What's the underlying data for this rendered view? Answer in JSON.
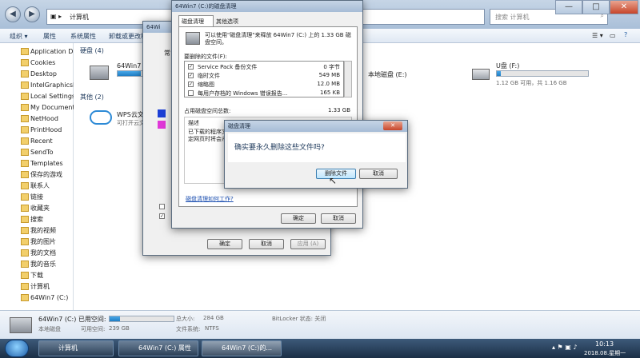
{
  "explorer": {
    "address": [
      "计算机"
    ],
    "search_placeholder": "搜索 计算机",
    "toolbar": [
      "组织 ▾",
      "属性",
      "系统属性",
      "卸载或更改程序"
    ],
    "sidebar": [
      "Application D",
      "Cookies",
      "Desktop",
      "IntelGraphicsP",
      "Local Settings",
      "My Document",
      "NetHood",
      "PrintHood",
      "Recent",
      "SendTo",
      "Templates",
      "保存的游戏",
      "联系人",
      "链接",
      "收藏夹",
      "搜索",
      "我的视频",
      "我的图片",
      "我的文档",
      "我的音乐",
      "下载",
      "计算机",
      "64Win7 (C:)"
    ],
    "groups": {
      "drives": "硬盘 (4)",
      "others": "其他 (2)"
    },
    "drive_c": {
      "name": "64Win7",
      "usage": 0.85
    },
    "drive_e": {
      "name": "本地磁盘 (E:)"
    },
    "drive_f": {
      "name": "U盘 (F:)",
      "detail": "1.12 GB 可用，共 1.16 GB",
      "usage": 0.04
    },
    "wps": {
      "name": "WPS云文档",
      "sub": "可打开云文档"
    },
    "status": {
      "name": "64Win7 (C:) 已用空间:",
      "type": "本地磁盘",
      "free_label": "可用空间:",
      "free": "239 GB",
      "total_label": "总大小:",
      "total": "284 GB",
      "fs_label": "文件系统:",
      "fs": "NTFS",
      "bitlocker": "BitLocker 状态: 关闭",
      "usage": 0.16
    }
  },
  "props_dialog": {
    "title": "64Wi",
    "tab": "常"
  },
  "cleanup": {
    "title": "64Win7 (C:)的磁盘清理",
    "tabs": [
      "磁盘清理",
      "其他选项"
    ],
    "intro": "可以使用\"磁盘清理\"来释放 64Win7 (C:) 上的 1.33 GB 磁盘空间。",
    "list_label": "要删除的文件(F):",
    "files": [
      {
        "checked": true,
        "name": "Service Pack 备份文件",
        "size": "0 字节"
      },
      {
        "checked": true,
        "name": "临时文件",
        "size": "549 MB"
      },
      {
        "checked": true,
        "name": "缩略图",
        "size": "12.0 MB"
      },
      {
        "checked": false,
        "name": "每用户存档的 Windows 错误报告...",
        "size": "165 KB"
      }
    ],
    "total_label": "占用磁盘空间总数:",
    "total": "1.33 GB",
    "desc_label": "描述",
    "desc": "已下载的程序文件包括 ActiveX 控件和 Java 小程序，您查看特定网页时将会从 Internet 自动下载。",
    "link": "磁盘清理如何工作?",
    "ok": "确定",
    "cancel": "取消"
  },
  "props_buttons": {
    "ok": "确定",
    "cancel": "取消",
    "apply": "应用 (A)"
  },
  "confirm": {
    "title": "磁盘清理",
    "message": "确实要永久删除这些文件吗?",
    "delete": "删除文件",
    "cancel": "取消"
  },
  "taskbar": {
    "items": [
      "计算机",
      "64Win7 (C:) 属性",
      "64Win7 (C:)的..."
    ],
    "time": "10:13",
    "date": "2018.08.星期一"
  }
}
